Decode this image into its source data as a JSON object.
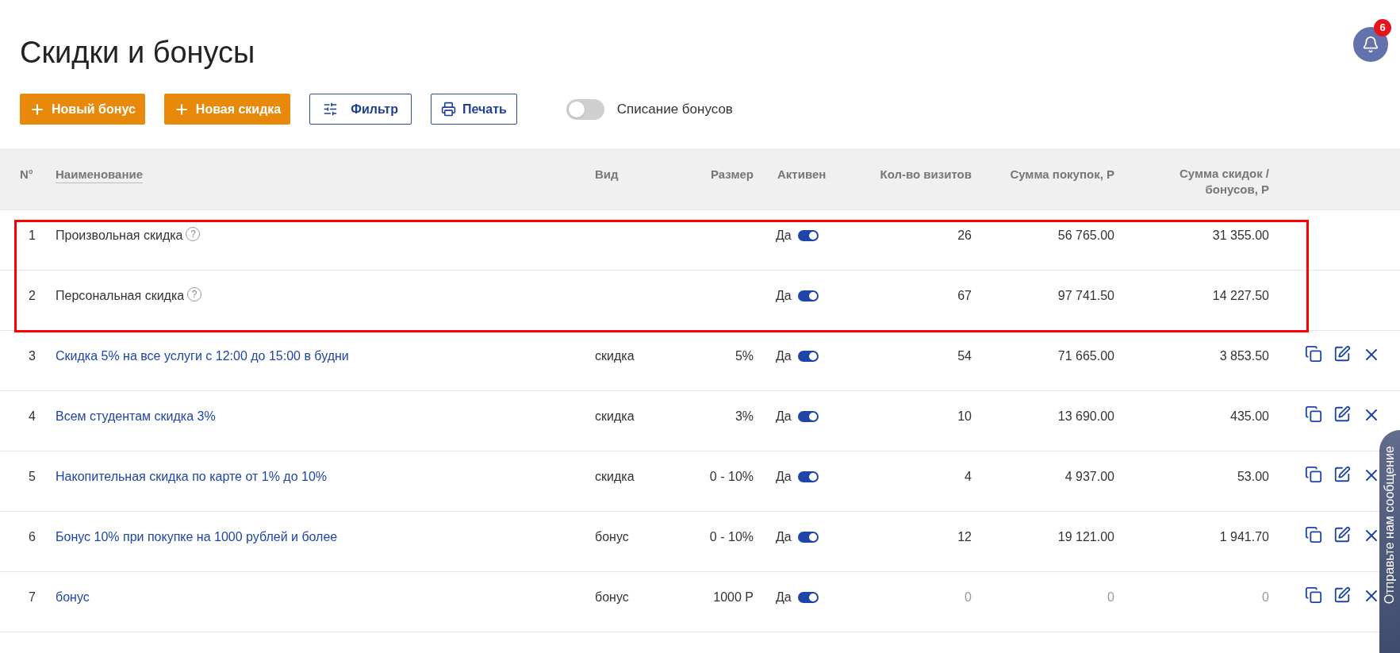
{
  "page": {
    "title": "Скидки и бонусы"
  },
  "notifications": {
    "count": "6"
  },
  "toolbar": {
    "buttons": [
      {
        "label": "Новый бонус",
        "kind": "add"
      },
      {
        "label": "Новая скидка",
        "kind": "add"
      },
      {
        "label": "Фильтр",
        "kind": "filter"
      },
      {
        "label": "Печать",
        "kind": "print"
      }
    ],
    "toggle": {
      "label": "Списание бонусов",
      "on": false
    }
  },
  "table": {
    "columns": [
      {
        "label": "N°",
        "sortable": false
      },
      {
        "label": "Наименование",
        "sortable": true
      },
      {
        "label": "Вид",
        "sortable": false
      },
      {
        "label": "Размер",
        "sortable": false
      },
      {
        "label": "Активен",
        "sortable": false
      },
      {
        "label": "Кол-во визитов",
        "sortable": false
      },
      {
        "label": "Сумма покупок, Р",
        "sortable": false
      },
      {
        "label": "Сумма скидок / бонусов, Р",
        "sortable": false
      }
    ],
    "rows": [
      {
        "number": "1",
        "name": "Произвольная скидка",
        "help": "?",
        "kind": "system",
        "highlighted": true,
        "active_label": "Да",
        "active": true,
        "visits": "26",
        "purchases": "56 765.00",
        "discounts": "31 355.00",
        "muted": false
      },
      {
        "number": "2",
        "name": "Персональная скидка",
        "help": "?",
        "kind": "system",
        "highlighted": true,
        "active_label": "Да",
        "active": true,
        "visits": "67",
        "purchases": "97 741.50",
        "discounts": "14 227.50",
        "muted": false
      },
      {
        "number": "3",
        "name": "Скидка 5% на все услуги с 12:00 до 15:00 в будни",
        "kind": "link",
        "highlighted": false,
        "type": "скидка",
        "size": "5%",
        "active_label": "Да",
        "active": true,
        "visits": "54",
        "purchases": "71 665.00",
        "discounts": "3 853.50",
        "muted": false
      },
      {
        "number": "4",
        "name": "Всем студентам скидка 3%",
        "kind": "link",
        "highlighted": false,
        "type": "скидка",
        "size": "3%",
        "active_label": "Да",
        "active": true,
        "visits": "10",
        "purchases": "13 690.00",
        "discounts": "435.00",
        "muted": false
      },
      {
        "number": "5",
        "name": "Накопительная скидка по карте от 1% до 10%",
        "kind": "link",
        "highlighted": false,
        "type": "скидка",
        "size": "0 - 10%",
        "active_label": "Да",
        "active": true,
        "visits": "4",
        "purchases": "4 937.00",
        "discounts": "53.00",
        "muted": false
      },
      {
        "number": "6",
        "name": "Бонус 10% при покупке на 1000 рублей и более",
        "kind": "link",
        "highlighted": false,
        "type": "бонус",
        "size": "0 - 10%",
        "active_label": "Да",
        "active": true,
        "visits": "12",
        "purchases": "19 121.00",
        "discounts": "1 941.70",
        "muted": false
      },
      {
        "number": "7",
        "name": "бонус",
        "kind": "link",
        "highlighted": false,
        "type": "бонус",
        "size": "1000 Р",
        "active_label": "Да",
        "active": true,
        "visits": "0",
        "purchases": "0",
        "discounts": "0",
        "muted": true
      }
    ]
  },
  "feedback": {
    "label": "Отправьте нам сообщение"
  }
}
